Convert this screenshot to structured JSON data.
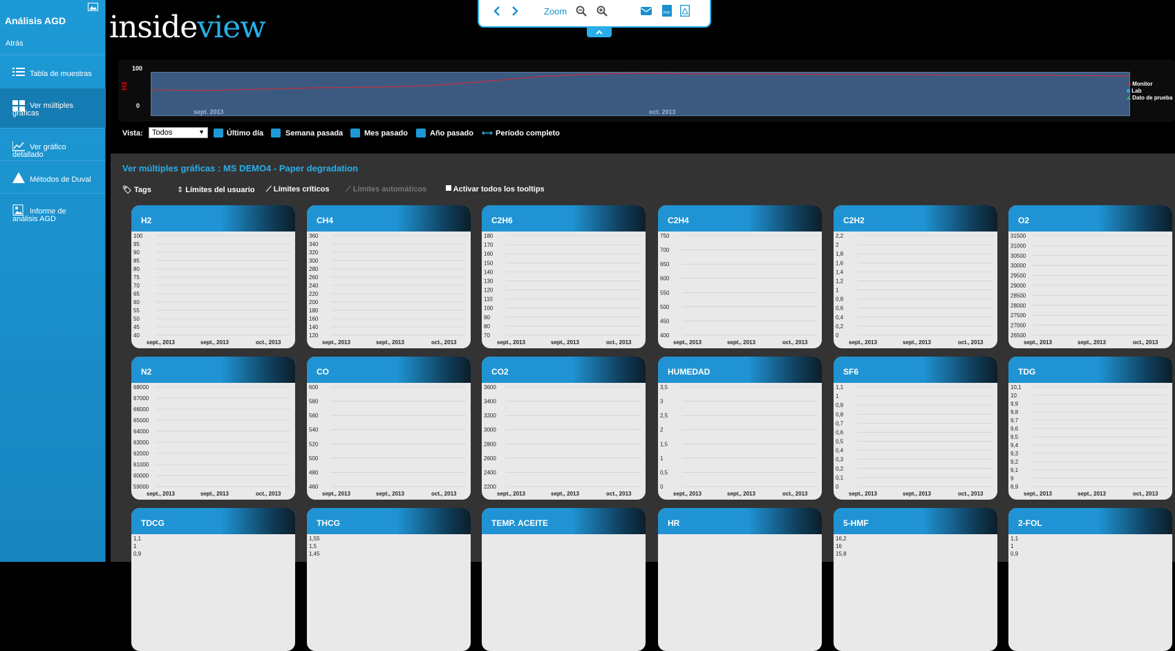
{
  "app": {
    "title": "Análisis AGD",
    "back_label": "Atrás"
  },
  "sidebar": {
    "items": [
      {
        "label": "Tabla de muestras",
        "icon": "list-icon"
      },
      {
        "label": "Ver múltiples gráficas",
        "icon": "grid-icon",
        "active": true
      },
      {
        "label": "Ver gráfico detallado",
        "icon": "line-chart-icon"
      },
      {
        "label": "Métodos de Duval",
        "icon": "triangle-icon"
      },
      {
        "label": "Informe de análisis AGD",
        "icon": "report-icon"
      }
    ]
  },
  "logo": {
    "part1": "inside",
    "part2": "view"
  },
  "toolbar": {
    "zoom_label": "Zoom",
    "icons": [
      "prev-icon",
      "next-icon",
      "zoom-out-icon",
      "zoom-in-icon",
      "email-icon",
      "pdf-icon",
      "pdf-export-icon"
    ]
  },
  "overview": {
    "y_axis_label": "H2",
    "y_ticks": [
      "100",
      "0"
    ],
    "x_ticks": [
      "sept. 2013",
      "oct. 2013"
    ],
    "legend": [
      "Monitor",
      "Lab",
      "Dato de prueba"
    ]
  },
  "controls": {
    "vista_label": "Vista:",
    "vista_value": "Todos",
    "ranges": [
      "Último día",
      "Semana pasada",
      "Mes pasado",
      "Año pasado",
      "Período completo"
    ]
  },
  "section": {
    "title": "Ver múltiples gráficas : MS DEMO4 - Paper degradation"
  },
  "tags": {
    "tags_label": "Tags",
    "user_limits": "Límites del usuario",
    "critical_limits": "Límites críticos",
    "auto_limits": "Límites automáticos",
    "tooltips": "Activar todos los tooltips"
  },
  "colors": {
    "accent": "#29aee9",
    "sidebar": "#1d9ad6",
    "h2": "#ff0000",
    "ch4": "#c000c8",
    "c2h6": "#f2b134",
    "c2h4": "#2e8c8c",
    "n2": "#f0a050",
    "co": "#38c038",
    "co2": "#2a4a9a",
    "limit_red": "#ff2020",
    "limit_orange": "#ff8c00"
  },
  "charts": [
    {
      "title": "H2",
      "x_labels": [
        "sept., 2013",
        "sept., 2013",
        "oct., 2013"
      ],
      "y_ticks": [
        "100",
        "95",
        "90",
        "85",
        "80",
        "75",
        "70",
        "65",
        "60",
        "55",
        "50",
        "45",
        "40"
      ]
    },
    {
      "title": "CH4",
      "x_labels": [
        "sept., 2013",
        "sept., 2013",
        "oct., 2013"
      ],
      "y_ticks": [
        "360",
        "340",
        "320",
        "300",
        "280",
        "260",
        "240",
        "220",
        "200",
        "180",
        "160",
        "140",
        "120"
      ]
    },
    {
      "title": "C2H6",
      "x_labels": [
        "sept., 2013",
        "sept., 2013",
        "oct., 2013"
      ],
      "y_ticks": [
        "180",
        "170",
        "160",
        "150",
        "140",
        "130",
        "120",
        "110",
        "100",
        "90",
        "80",
        "70"
      ]
    },
    {
      "title": "C2H4",
      "x_labels": [
        "sept., 2013",
        "sept., 2013",
        "oct., 2013"
      ],
      "y_ticks": [
        "750",
        "700",
        "650",
        "600",
        "550",
        "500",
        "450",
        "400"
      ]
    },
    {
      "title": "C2H2",
      "x_labels": [
        "sept., 2013",
        "sept., 2013",
        "oct., 2013"
      ],
      "y_ticks": [
        "2,2",
        "2",
        "1,8",
        "1,6",
        "1,4",
        "1,2",
        "1",
        "0,8",
        "0,6",
        "0,4",
        "0,2",
        "0"
      ]
    },
    {
      "title": "O2",
      "x_labels": [
        "sept., 2013",
        "sept., 2013",
        "oct., 2013"
      ],
      "y_ticks": [
        "31500",
        "31000",
        "30500",
        "30000",
        "29500",
        "29000",
        "28500",
        "28000",
        "27500",
        "27000",
        "26500"
      ]
    },
    {
      "title": "N2",
      "x_labels": [
        "sept., 2013",
        "sept., 2013",
        "oct., 2013"
      ],
      "y_ticks": [
        "68000",
        "67000",
        "66000",
        "65000",
        "64000",
        "63000",
        "62000",
        "61000",
        "60000",
        "59000"
      ]
    },
    {
      "title": "CO",
      "x_labels": [
        "sept., 2013",
        "sept., 2013",
        "oct., 2013"
      ],
      "y_ticks": [
        "600",
        "580",
        "560",
        "540",
        "520",
        "500",
        "480",
        "460"
      ]
    },
    {
      "title": "CO2",
      "x_labels": [
        "sept., 2013",
        "sept., 2013",
        "oct., 2013"
      ],
      "y_ticks": [
        "3600",
        "3400",
        "3200",
        "3000",
        "2800",
        "2600",
        "2400",
        "2200"
      ]
    },
    {
      "title": "HUMEDAD",
      "x_labels": [
        "sept., 2013",
        "sept., 2013",
        "oct., 2013"
      ],
      "y_ticks": [
        "3,5",
        "3",
        "2,5",
        "2",
        "1,5",
        "1",
        "0,5",
        "0"
      ]
    },
    {
      "title": "SF6",
      "x_labels": [
        "sept., 2013",
        "sept., 2013",
        "oct., 2013"
      ],
      "y_ticks": [
        "1,1",
        "1",
        "0,9",
        "0,8",
        "0,7",
        "0,6",
        "0,5",
        "0,4",
        "0,3",
        "0,2",
        "0,1",
        "0"
      ]
    },
    {
      "title": "TDG",
      "x_labels": [
        "sept., 2013",
        "sept., 2013",
        "oct., 2013"
      ],
      "y_ticks": [
        "10,1",
        "10",
        "9,9",
        "9,8",
        "9,7",
        "9,6",
        "9,5",
        "9,4",
        "9,3",
        "9,2",
        "9,1",
        "9",
        "8,9"
      ]
    },
    {
      "title": "TDCG",
      "x_labels": [],
      "y_ticks": [
        "1,1",
        "1",
        "0,9"
      ]
    },
    {
      "title": "THCG",
      "x_labels": [],
      "y_ticks": [
        "1,55",
        "1,5",
        "1,45"
      ]
    },
    {
      "title": "TEMP. ACEITE",
      "x_labels": [],
      "y_ticks": []
    },
    {
      "title": "HR",
      "x_labels": [],
      "y_ticks": []
    },
    {
      "title": "5-HMF",
      "x_labels": [],
      "y_ticks": [
        "16,2",
        "16",
        "15,8"
      ]
    },
    {
      "title": "2-FOL",
      "x_labels": [],
      "y_ticks": [
        "1,1",
        "1",
        "0,9"
      ]
    }
  ]
}
